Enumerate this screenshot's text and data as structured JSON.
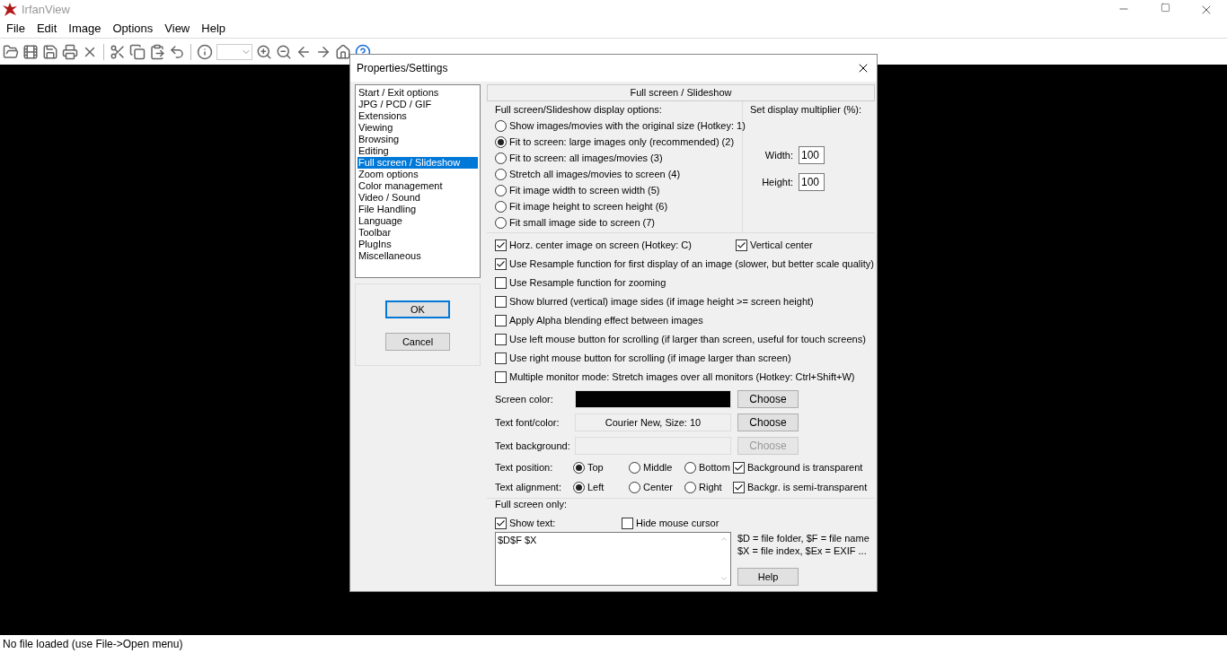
{
  "window": {
    "title": "IrfanView"
  },
  "menu": [
    "File",
    "Edit",
    "Image",
    "Options",
    "View",
    "Help"
  ],
  "status_bar": "No file loaded (use File->Open menu)",
  "dialog": {
    "title": "Properties/Settings",
    "categories": [
      {
        "label": "Start / Exit options",
        "selected": false
      },
      {
        "label": "JPG / PCD / GIF",
        "selected": false
      },
      {
        "label": "Extensions",
        "selected": false
      },
      {
        "label": "Viewing",
        "selected": false
      },
      {
        "label": "Browsing",
        "selected": false
      },
      {
        "label": "Editing",
        "selected": false
      },
      {
        "label": "Full screen / Slideshow",
        "selected": true
      },
      {
        "label": "Zoom options",
        "selected": false
      },
      {
        "label": "Color management",
        "selected": false
      },
      {
        "label": "Video / Sound",
        "selected": false
      },
      {
        "label": "File Handling",
        "selected": false
      },
      {
        "label": "Language",
        "selected": false
      },
      {
        "label": "Toolbar",
        "selected": false
      },
      {
        "label": "PlugIns",
        "selected": false
      },
      {
        "label": "Miscellaneous",
        "selected": false
      }
    ],
    "buttons": [
      {
        "label": "OK",
        "default": true
      },
      {
        "label": "Cancel",
        "default": false
      }
    ],
    "page_title": "Full screen / Slideshow",
    "display_options": {
      "title": "Full screen/Slideshow display options:",
      "options": [
        {
          "label": "Show images/movies with the original size (Hotkey: 1)",
          "selected": false
        },
        {
          "label": "Fit to screen: large images only (recommended) (2)",
          "selected": true
        },
        {
          "label": "Fit to screen: all images/movies (3)",
          "selected": false
        },
        {
          "label": "Stretch all images/movies to screen (4)",
          "selected": false
        },
        {
          "label": "Fit image width to screen width (5)",
          "selected": false
        },
        {
          "label": "Fit image height to screen height (6)",
          "selected": false
        },
        {
          "label": "Fit small image side to screen (7)",
          "selected": false
        }
      ]
    },
    "multiplier": {
      "title": "Set display multiplier (%):",
      "fields": [
        {
          "label": "Width:",
          "value": "100"
        },
        {
          "label": "Height:",
          "value": "100"
        }
      ]
    },
    "center_checks": [
      {
        "label": "Horz. center image on screen (Hotkey: C)",
        "checked": true
      },
      {
        "label": "Vertical center",
        "checked": true
      }
    ],
    "checks": [
      {
        "label": "Use Resample function for first display of an image (slower, but better scale quality)",
        "checked": true
      },
      {
        "label": "Use Resample function for zooming",
        "checked": false
      },
      {
        "label": "Show blurred (vertical) image sides (if image height >= screen height)",
        "checked": false
      },
      {
        "label": "Apply Alpha blending effect between images",
        "checked": false
      },
      {
        "label": "Use left mouse button for scrolling (if larger than screen, useful for touch screens)",
        "checked": false
      },
      {
        "label": "Use right mouse button for scrolling (if image larger than screen)",
        "checked": false
      },
      {
        "label": "Multiple monitor mode: Stretch images over all monitors (Hotkey: Ctrl+Shift+W)",
        "checked": false
      }
    ],
    "color_rows": [
      {
        "label": "Screen color:",
        "kind": "swatch",
        "color": "#000000",
        "button": {
          "label": "Choose",
          "disabled": false
        }
      },
      {
        "label": "Text font/color:",
        "kind": "text",
        "value": "Courier New, Size: 10",
        "button": {
          "label": "Choose",
          "disabled": false
        }
      },
      {
        "label": "Text background:",
        "kind": "empty",
        "button": {
          "label": "Choose",
          "disabled": true
        }
      }
    ],
    "radio_rows": [
      {
        "label": "Text position:",
        "options": [
          {
            "label": "Top",
            "selected": true
          },
          {
            "label": "Middle",
            "selected": false
          },
          {
            "label": "Bottom",
            "selected": false
          }
        ],
        "check": {
          "label": "Background is transparent",
          "checked": true
        }
      },
      {
        "label": "Text alignment:",
        "options": [
          {
            "label": "Left",
            "selected": true
          },
          {
            "label": "Center",
            "selected": false
          },
          {
            "label": "Right",
            "selected": false
          }
        ],
        "check": {
          "label": "Backgr. is semi-transparent",
          "checked": true
        }
      }
    ],
    "full_screen_only": {
      "title": "Full screen only:",
      "show_text": {
        "label": "Show text:",
        "checked": true
      },
      "hide_cursor": {
        "label": "Hide mouse cursor",
        "checked": false
      },
      "text": "$D$F $X",
      "hints": [
        "$D = file folder, $F = file name",
        "$X = file index, $Ex = EXIF ..."
      ],
      "help": "Help"
    }
  }
}
